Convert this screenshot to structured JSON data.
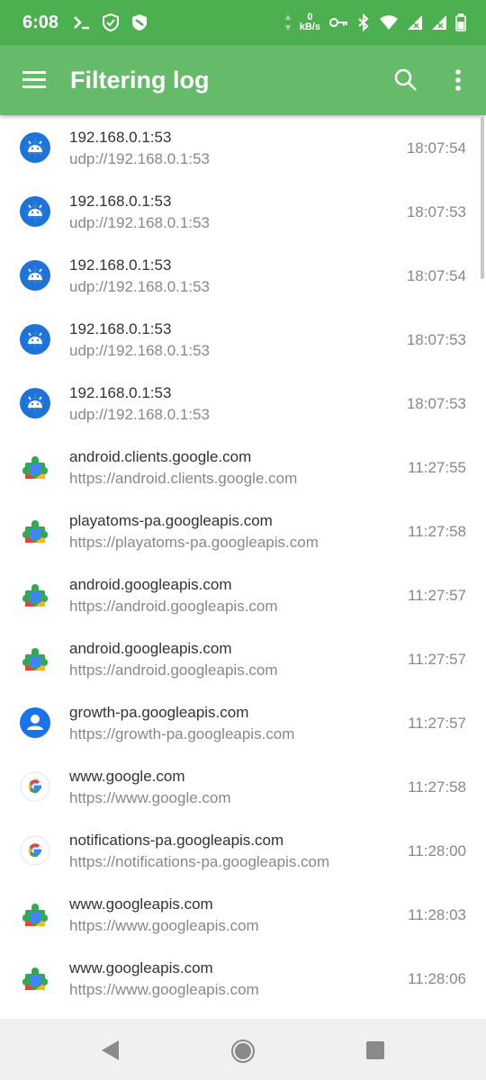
{
  "status_bar": {
    "time": "6:08",
    "net_speed_value": "0",
    "net_speed_unit": "kB/s"
  },
  "app_bar": {
    "title": "Filtering log"
  },
  "entries": [
    {
      "host": "192.168.0.1:53",
      "url": "udp://192.168.0.1:53",
      "time": "18:07:54",
      "icon": "android-icon"
    },
    {
      "host": "192.168.0.1:53",
      "url": "udp://192.168.0.1:53",
      "time": "18:07:53",
      "icon": "android-icon"
    },
    {
      "host": "192.168.0.1:53",
      "url": "udp://192.168.0.1:53",
      "time": "18:07:54",
      "icon": "android-icon"
    },
    {
      "host": "192.168.0.1:53",
      "url": "udp://192.168.0.1:53",
      "time": "18:07:53",
      "icon": "android-icon"
    },
    {
      "host": "192.168.0.1:53",
      "url": "udp://192.168.0.1:53",
      "time": "18:07:53",
      "icon": "android-icon"
    },
    {
      "host": "android.clients.google.com",
      "url": "https://android.clients.google.com",
      "time": "11:27:55",
      "icon": "play-services-icon"
    },
    {
      "host": "playatoms-pa.googleapis.com",
      "url": "https://playatoms-pa.googleapis.com",
      "time": "11:27:58",
      "icon": "play-services-icon"
    },
    {
      "host": "android.googleapis.com",
      "url": "https://android.googleapis.com",
      "time": "11:27:57",
      "icon": "play-services-icon"
    },
    {
      "host": "android.googleapis.com",
      "url": "https://android.googleapis.com",
      "time": "11:27:57",
      "icon": "play-services-icon"
    },
    {
      "host": "growth-pa.googleapis.com",
      "url": "https://growth-pa.googleapis.com",
      "time": "11:27:57",
      "icon": "account-icon"
    },
    {
      "host": "www.google.com",
      "url": "https://www.google.com",
      "time": "11:27:58",
      "icon": "google-icon"
    },
    {
      "host": "notifications-pa.googleapis.com",
      "url": "https://notifications-pa.googleapis.com",
      "time": "11:28:00",
      "icon": "google-icon"
    },
    {
      "host": "www.googleapis.com",
      "url": "https://www.googleapis.com",
      "time": "11:28:03",
      "icon": "play-services-icon"
    },
    {
      "host": "www.googleapis.com",
      "url": "https://www.googleapis.com",
      "time": "11:28:06",
      "icon": "play-services-icon"
    }
  ],
  "colors": {
    "status_bar": "#4caf50",
    "app_bar": "#66bb6a",
    "android_icon_bg": "#1e73d6",
    "account_icon_bg": "#1a73e8"
  }
}
